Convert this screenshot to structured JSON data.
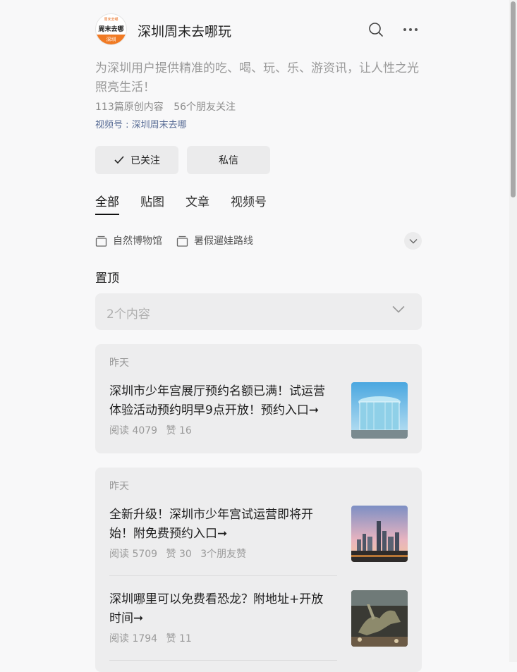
{
  "account": {
    "logo_text_top": "周末去哪",
    "logo_text_main": "周末去哪",
    "logo_text_city": "深圳",
    "name": "深圳周末去哪玩",
    "description": "为深圳用户提供精准的吃、喝、玩、乐、游资讯，让人性之光照亮生活！",
    "original_count": "113篇原创内容",
    "friends_follow": "56个朋友关注",
    "channel": "视频号 : 深圳周末去哪"
  },
  "actions": {
    "followed_label": "已关注",
    "message_label": "私信"
  },
  "tabs": [
    {
      "label": "全部",
      "active": true
    },
    {
      "label": "贴图",
      "active": false
    },
    {
      "label": "文章",
      "active": false
    },
    {
      "label": "视频号",
      "active": false
    }
  ],
  "collections": [
    {
      "label": "自然博物馆"
    },
    {
      "label": "暑假遛娃路线"
    }
  ],
  "pinned": {
    "title": "置顶",
    "count_label": "2个内容"
  },
  "cards": [
    {
      "date": "昨天",
      "articles": [
        {
          "title": "深圳市少年宫展厅预约名额已满！试运营体验活动预约明早9点开放！预约入口➞",
          "reads": "阅读 4079",
          "likes": "赞 16",
          "friends": ""
        }
      ]
    },
    {
      "date": "昨天",
      "articles": [
        {
          "title": "全新升级！深圳市少年宫试运营即将开始！附免费预约入口➞",
          "reads": "阅读 5709",
          "likes": "赞 30",
          "friends": "3个朋友赞"
        },
        {
          "title": "深圳哪里可以免费看恐龙？附地址+开放时间➞",
          "reads": "阅读 1794",
          "likes": "赞 11",
          "friends": ""
        }
      ]
    }
  ],
  "icons": {
    "search": "search-icon",
    "more": "more-icon",
    "check": "check-icon",
    "collection": "collection-icon",
    "chevron": "chevron-down-icon"
  },
  "colors": {
    "brand_orange": "#f07a24",
    "link_blue": "#576b95",
    "card_bg": "#ededee"
  }
}
